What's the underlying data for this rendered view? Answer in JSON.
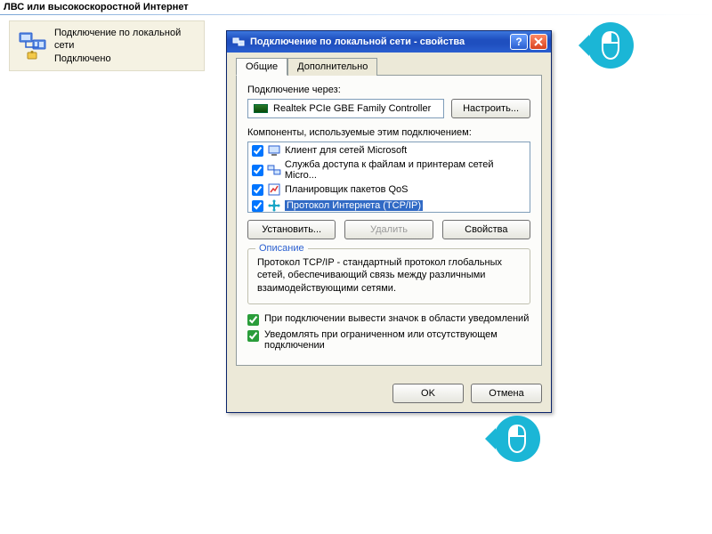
{
  "section": {
    "title": "ЛВС или высокоскоростной Интернет"
  },
  "connection": {
    "name": "Подключение по локальной сети",
    "status": "Подключено"
  },
  "dialog": {
    "title": "Подключение по локальной сети - свойства",
    "tabs": {
      "general": "Общие",
      "advanced": "Дополнительно"
    },
    "connect_via_label": "Подключение через:",
    "adapter_name": "Realtek PCIe GBE Family Controller",
    "configure_btn": "Настроить...",
    "components_label": "Компоненты, используемые этим подключением:",
    "components": [
      {
        "label": "Клиент для сетей Microsoft",
        "checked": true,
        "icon": "client-icon"
      },
      {
        "label": "Служба доступа к файлам и принтерам сетей Micro...",
        "checked": true,
        "icon": "service-icon"
      },
      {
        "label": "Планировщик пакетов QoS",
        "checked": true,
        "icon": "qos-icon"
      },
      {
        "label": "Протокол Интернета (TCP/IP)",
        "checked": true,
        "icon": "protocol-icon",
        "selected": true
      }
    ],
    "install_btn": "Установить...",
    "remove_btn": "Удалить",
    "properties_btn": "Свойства",
    "description_legend": "Описание",
    "description_text": "Протокол TCP/IP - стандартный протокол глобальных сетей, обеспечивающий связь между различными взаимодействующими сетями.",
    "show_icon_label": "При подключении вывести значок в области уведомлений",
    "notify_limited_label": "Уведомлять при ограниченном или отсутствующем подключении",
    "ok_btn": "OK",
    "cancel_btn": "Отмена"
  }
}
